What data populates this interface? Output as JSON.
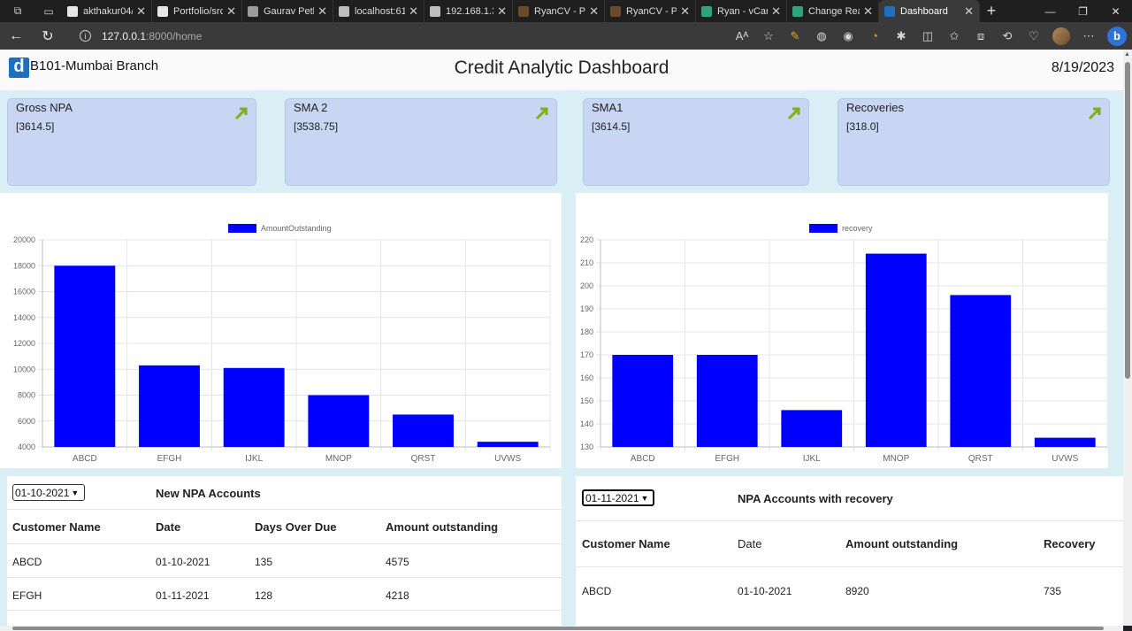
{
  "browser": {
    "tabs": [
      {
        "label": "akthakur04/",
        "color": "#e6e6e6"
      },
      {
        "label": "Portfolio/src",
        "color": "#e6e6e6"
      },
      {
        "label": "Gaurav Petk",
        "color": "#9b9b9b"
      },
      {
        "label": "localhost:61",
        "color": "#bdbdbd"
      },
      {
        "label": "192.168.1.3",
        "color": "#bdbdbd"
      },
      {
        "label": "RyanCV - Pe",
        "color": "#6b4a2b"
      },
      {
        "label": "RyanCV - Pe",
        "color": "#6b4a2b"
      },
      {
        "label": "Ryan - vCar",
        "color": "#2fa37a"
      },
      {
        "label": "Change Rea",
        "color": "#2fa37a"
      },
      {
        "label": "Dashboard",
        "color": "#1e6fc0"
      }
    ],
    "url_host": "127.0.0.1",
    "url_path": ":8000/home"
  },
  "header": {
    "branch": "B101-Mumbai Branch",
    "title": "Credit Analytic Dashboard",
    "date": "8/19/2023"
  },
  "cards": [
    {
      "label": "Gross NPA",
      "value": "[3614.5]"
    },
    {
      "label": "SMA 2",
      "value": "[3538.75]"
    },
    {
      "label": "SMA1",
      "value": "[3614.5]"
    },
    {
      "label": "Recoveries",
      "value": "[318.0]"
    }
  ],
  "chart_data": [
    {
      "type": "bar",
      "categories": [
        "ABCD",
        "EFGH",
        "IJKL",
        "MNOP",
        "QRST",
        "UVWS"
      ],
      "series": [
        {
          "name": "AmountOutstanding",
          "values": [
            18000,
            10300,
            10100,
            8000,
            6500,
            4400
          ],
          "color": "#0000ff"
        }
      ],
      "ylim": [
        4000,
        20000
      ],
      "yticks": [
        4000,
        6000,
        8000,
        10000,
        12000,
        14000,
        16000,
        18000,
        20000
      ],
      "grid": true,
      "legend": "top-center"
    },
    {
      "type": "bar",
      "categories": [
        "ABCD",
        "EFGH",
        "IJKL",
        "MNOP",
        "QRST",
        "UVWS"
      ],
      "series": [
        {
          "name": "recovery",
          "values": [
            170,
            170,
            146,
            214,
            196,
            134
          ],
          "color": "#0000ff"
        }
      ],
      "ylim": [
        130,
        220
      ],
      "yticks": [
        130,
        140,
        150,
        160,
        170,
        180,
        190,
        200,
        210,
        220
      ],
      "grid": true,
      "legend": "top-center"
    }
  ],
  "new_npa": {
    "filter": "01-10-2021",
    "title": "New NPA Accounts",
    "headers": [
      "Customer Name",
      "Date",
      "Days Over Due",
      "Amount outstanding"
    ],
    "rows": [
      [
        "ABCD",
        "01-10-2021",
        "135",
        "4575"
      ],
      [
        "EFGH",
        "01-11-2021",
        "128",
        "4218"
      ]
    ]
  },
  "npa_recovery": {
    "filter": "01-11-2021",
    "title": "NPA Accounts with recovery",
    "headers": [
      "Customer Name",
      "Date",
      "Amount outstanding",
      "Recovery"
    ],
    "rows": [
      [
        "ABCD",
        "01-10-2021",
        "8920",
        "735"
      ]
    ]
  }
}
